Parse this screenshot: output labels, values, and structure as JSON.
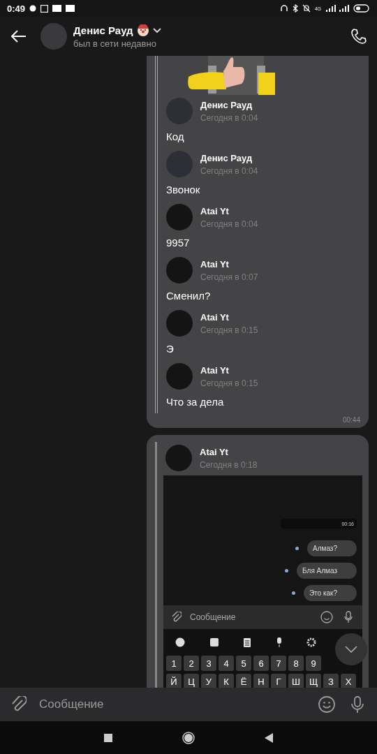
{
  "status_bar": {
    "time": "0:49",
    "network": "4G"
  },
  "header": {
    "name": "Денис Рауд",
    "status": "был в сети недавно"
  },
  "first_message": {
    "forwarded": [
      {
        "author": "Денис Рауд",
        "time": "Сегодня в 0:04",
        "text": "Код"
      },
      {
        "author": "Денис Рауд",
        "time": "Сегодня в 0:04",
        "text": "Звонок"
      },
      {
        "author": "Atai Yt",
        "time": "Сегодня в 0:04",
        "text": "9957"
      },
      {
        "author": "Atai Yt",
        "time": "Сегодня в 0:07",
        "text": "Сменил?"
      },
      {
        "author": "Atai Yt",
        "time": "Сегодня в 0:15",
        "text": "Э"
      },
      {
        "author": "Atai Yt",
        "time": "Сегодня в 0:15",
        "text": "Что за дела"
      }
    ],
    "time": "00:44"
  },
  "second_message": {
    "author": "Atai Yt",
    "time": "Сегодня в 0:18",
    "screenshot": {
      "voice_time": "00:16",
      "messages": [
        "Алмаз?",
        "Бля Алмаз",
        "Это как?"
      ],
      "placeholder": "Сообщение",
      "number_keys": [
        "1",
        "2",
        "3",
        "4",
        "5",
        "6",
        "7",
        "8",
        "9"
      ],
      "letter_keys": [
        "Й",
        "Ц",
        "У",
        "К",
        "Ё",
        "Н",
        "Г",
        "Ш",
        "Щ",
        "З",
        "Х"
      ]
    }
  },
  "composer": {
    "placeholder": "Сообщение"
  }
}
